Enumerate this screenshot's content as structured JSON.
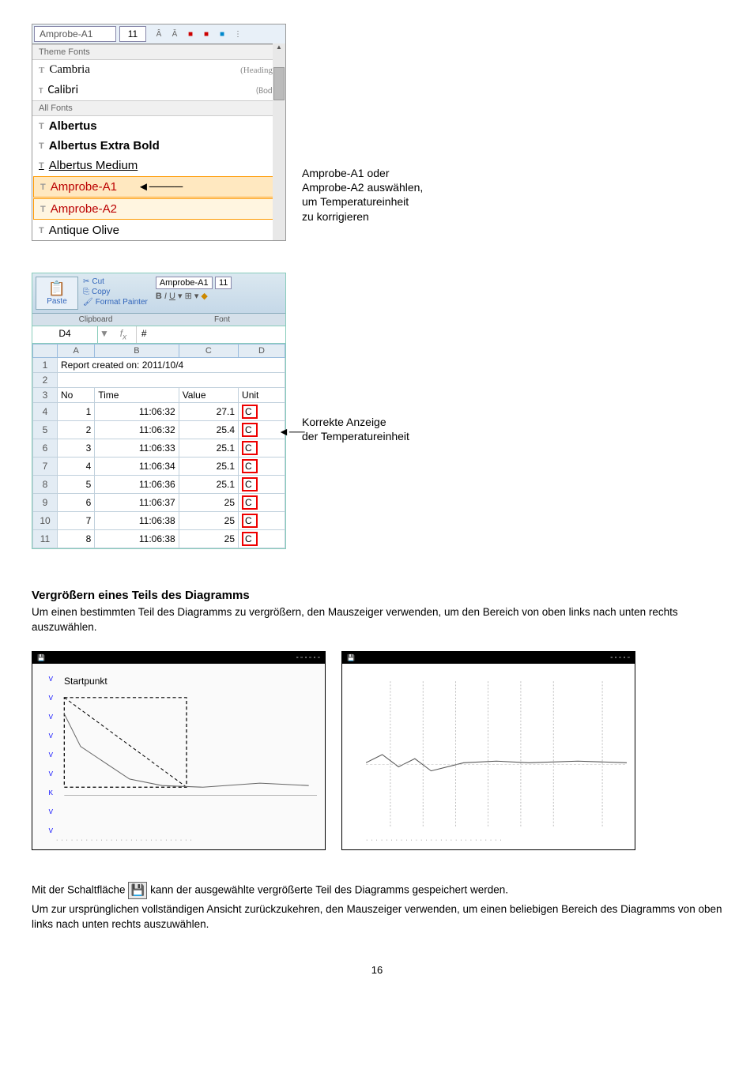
{
  "fontDropdown": {
    "currentFont": "Amprobe-A1",
    "fontSize": "11",
    "themeFontsLabel": "Theme Fonts",
    "allFontsLabel": "All Fonts",
    "cambria": "Cambria",
    "cambriaHint": "(Headings)",
    "calibri": "Calibri",
    "calibriHint": "(Body)",
    "albertus": "Albertus",
    "albertusExtra": "Albertus Extra Bold",
    "albertusMedium": "Albertus Medium",
    "amprobeA1": "Amprobe-A1",
    "amprobeA2": "Amprobe-A2",
    "antique": "Antique Olive"
  },
  "annotation1": {
    "line1": "Amprobe-A1 oder",
    "line2": "Amprobe-A2 auswählen,",
    "line3": "um Temperatureinheit",
    "line4": "zu korrigieren"
  },
  "excel": {
    "cut": "Cut",
    "copy": "Copy",
    "formatPainter": "Format Painter",
    "paste": "Paste",
    "clipboard": "Clipboard",
    "fontLabel": "Font",
    "fontName": "Amprobe-A1",
    "fontSize": "11",
    "cellRef": "D4",
    "fxVal": "#",
    "colA": "A",
    "colB": "B",
    "colC": "C",
    "colD": "D",
    "row1text": "Report created on: 2011/10/4",
    "hdrNo": "No",
    "hdrTime": "Time",
    "hdrValue": "Value",
    "hdrUnit": "Unit",
    "r4": {
      "no": "1",
      "time": "11:06:32",
      "val": "27.1",
      "unit": "C"
    },
    "r5": {
      "no": "2",
      "time": "11:06:32",
      "val": "25.4",
      "unit": "C"
    },
    "r6": {
      "no": "3",
      "time": "11:06:33",
      "val": "25.1",
      "unit": "C"
    },
    "r7": {
      "no": "4",
      "time": "11:06:34",
      "val": "25.1",
      "unit": "C"
    },
    "r8": {
      "no": "5",
      "time": "11:06:36",
      "val": "25.1",
      "unit": "C"
    },
    "r9": {
      "no": "6",
      "time": "11:06:37",
      "val": "25",
      "unit": "C"
    },
    "r10": {
      "no": "7",
      "time": "11:06:38",
      "val": "25",
      "unit": "C"
    },
    "r11": {
      "no": "8",
      "time": "11:06:38",
      "val": "25",
      "unit": "C"
    }
  },
  "annotation2": {
    "line1": "Korrekte Anzeige",
    "line2": "der Temperatureinheit"
  },
  "heading": "Vergrößern eines Teils des Diagramms",
  "para1": "Um einen bestimmten Teil des Diagramms zu vergrößern, den Mauszeiger verwenden, um den Bereich von oben links nach unten rechts auszuwählen.",
  "chartLabel": "Startpunkt",
  "para2a": "Mit der Schaltfläche ",
  "para2b": " kann der ausgewählte vergrößerte Teil des Diagramms gespeichert werden.",
  "para3": "Um zur ursprünglichen vollständigen Ansicht zurückzukehren, den Mauszeiger verwenden, um einen beliebigen Bereich des Diagramms von oben links nach unten rechts auszuwählen.",
  "pageNum": "16",
  "chart_data": [
    {
      "type": "line",
      "title": "",
      "y_ticks": [
        "V",
        "V",
        "V",
        "V",
        "V",
        "V",
        "K",
        "V",
        "V"
      ],
      "note": "left chart shows a dashed selection rectangle labeled Startpunkt over a noisy line",
      "series": [
        {
          "name": "trace",
          "values": []
        }
      ]
    },
    {
      "type": "line",
      "title": "",
      "note": "right chart shows zoomed portion with dotted vertical markers",
      "series": [
        {
          "name": "trace",
          "values": []
        }
      ]
    }
  ]
}
